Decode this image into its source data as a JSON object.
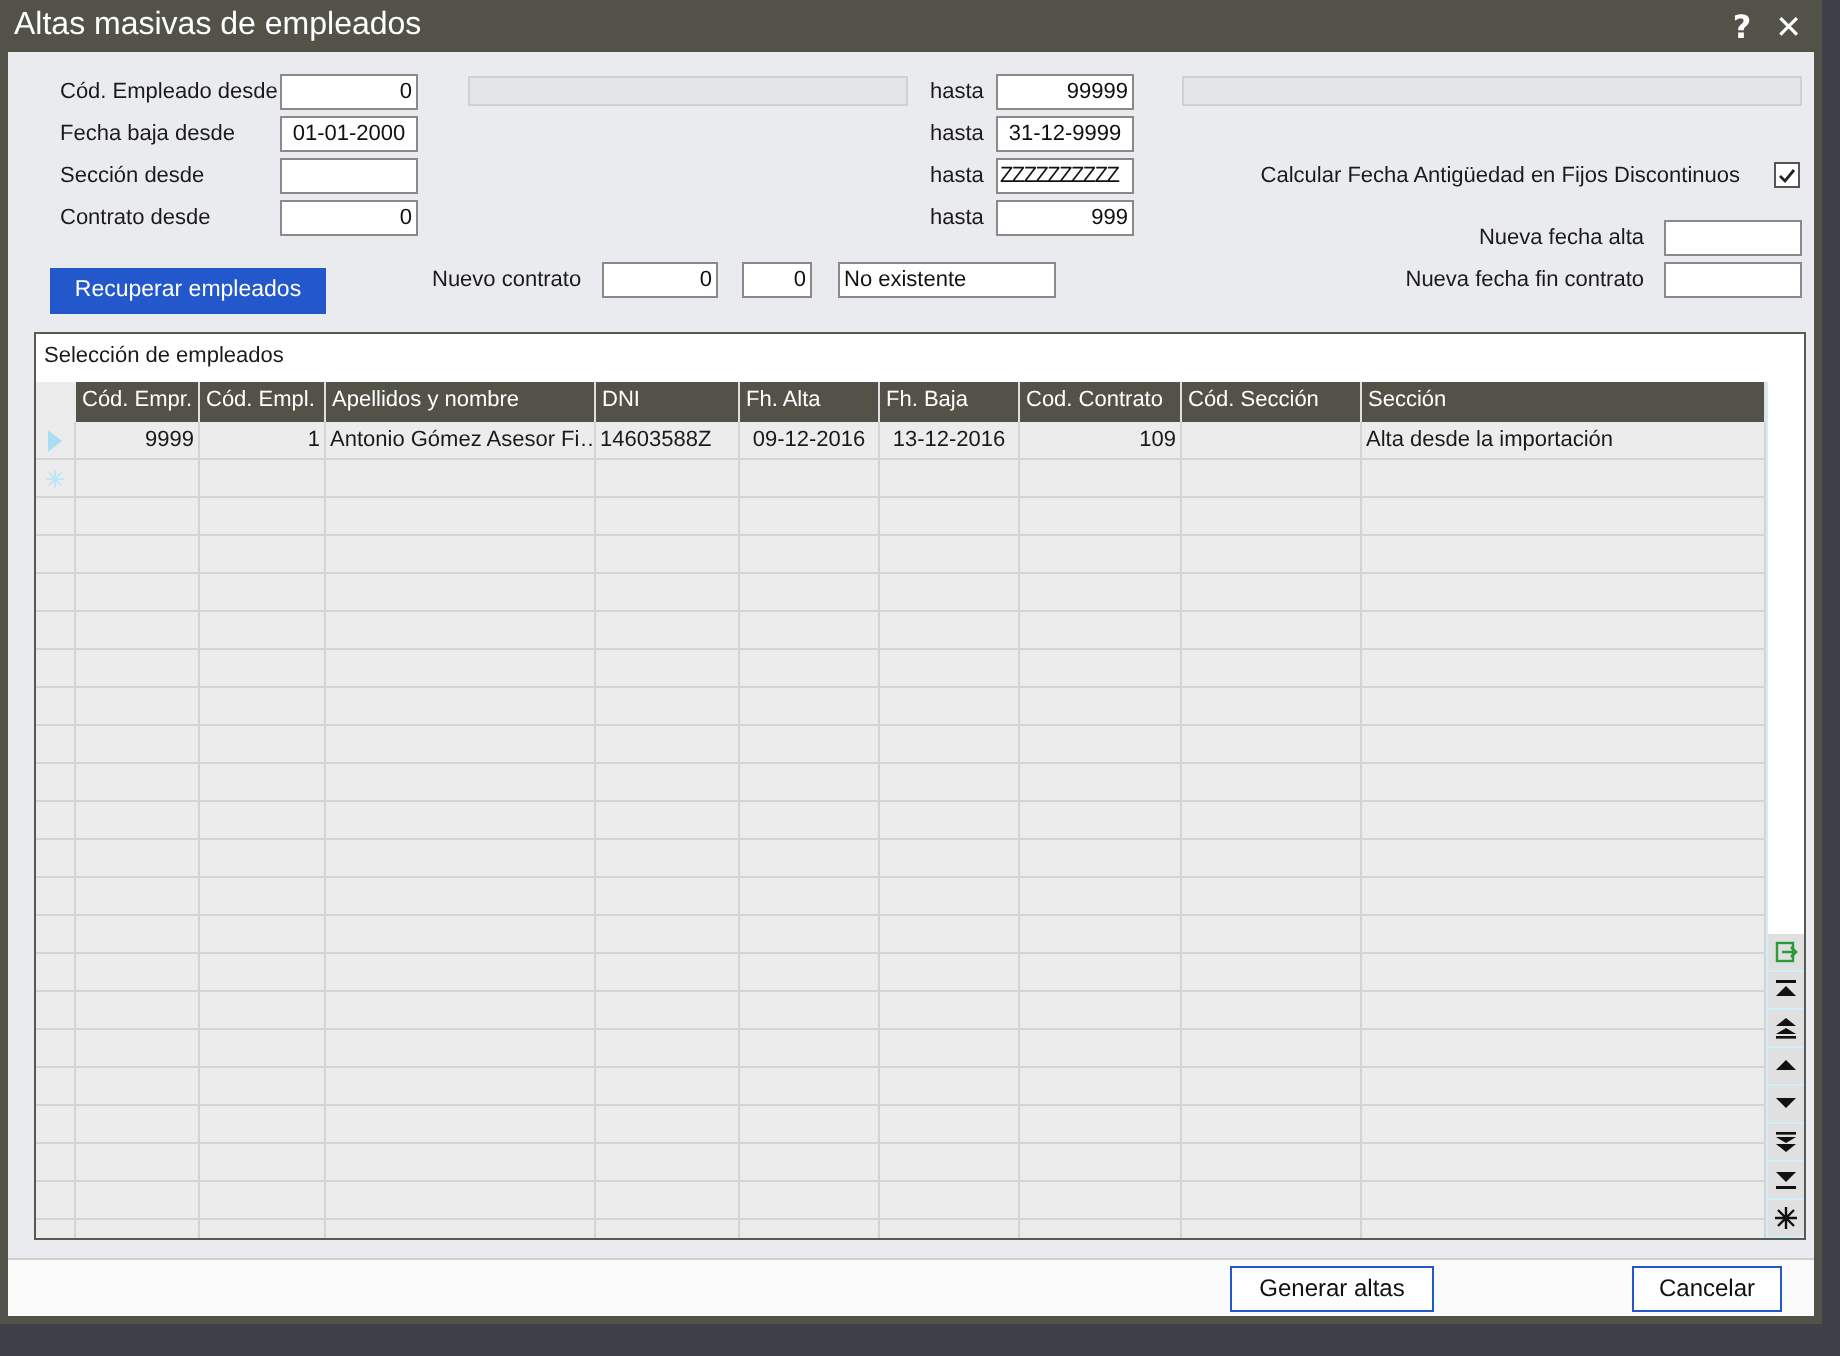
{
  "window": {
    "title": "Altas masivas de empleados",
    "help_button": "?",
    "close_button": "✕"
  },
  "filters": [
    {
      "label": "Cód. Empleado desde",
      "kind": "number",
      "from": "0",
      "to_label": "hasta",
      "to": "99999",
      "described": true
    },
    {
      "label": "Fecha baja desde",
      "kind": "date",
      "from": "01-01-2000",
      "to_label": "hasta",
      "to": "31-12-9999",
      "described": false
    },
    {
      "label": "Sección desde",
      "kind": "text",
      "to_label": "hasta",
      "to": "ZZZZZZZZZZ",
      "described": false
    },
    {
      "label": "Contrato desde",
      "kind": "number",
      "from": "0",
      "to_label": "hasta",
      "to": "999",
      "described": false
    }
  ],
  "option": {
    "label": "Calcular Fecha Antigüedad en Fijos Discontinuos",
    "checked": true
  },
  "retrieve_button": "Recuperar empleados",
  "new_contract": {
    "label": "Nuevo contrato",
    "code": "0",
    "code_2": "0",
    "description": "No existente"
  },
  "new_hire_date": {
    "label": "Nueva fecha alta"
  },
  "new_contract_end": {
    "label": "Nueva fecha fin contrato"
  },
  "table": {
    "title": "Selección de empleados",
    "columns": [
      {
        "label": "Cód. Empr.",
        "kind": "number"
      },
      {
        "label": "Cód. Empl.",
        "kind": "number"
      },
      {
        "label": "Apellidos y nombre",
        "kind": "text"
      },
      {
        "label": "DNI",
        "kind": "text"
      },
      {
        "label": "Fh. Alta",
        "kind": "date"
      },
      {
        "label": "Fh. Baja",
        "kind": "date"
      },
      {
        "label": "Cod. Contrato",
        "kind": "number"
      },
      {
        "label": "Cód. Sección",
        "kind": "text"
      },
      {
        "label": "Sección",
        "kind": "text"
      }
    ],
    "rows": [
      {
        "current": true,
        "cells": [
          "9999",
          "1",
          "Antonio Gómez Asesor Fi…",
          "14603588Z",
          "09-12-2016",
          "13-12-2016",
          "109",
          null,
          "Alta desde la importación"
        ]
      }
    ]
  },
  "buttons": [
    "Generar altas",
    "Cancelar"
  ]
}
